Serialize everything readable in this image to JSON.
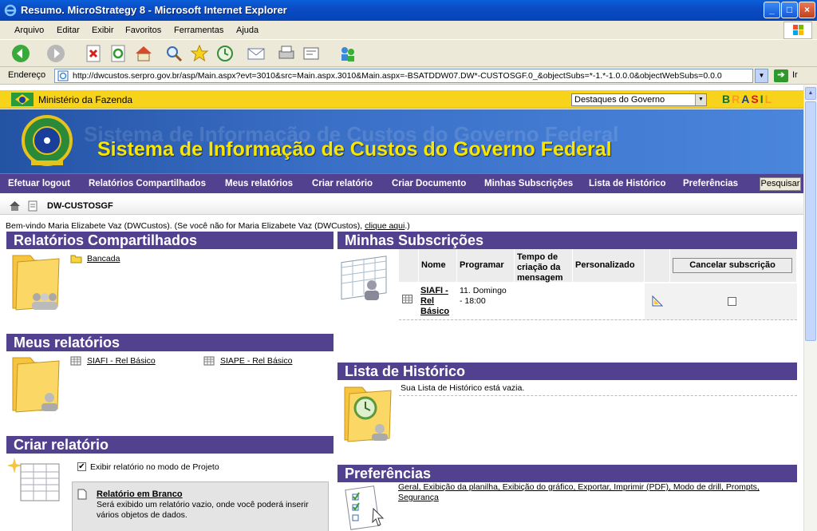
{
  "window": {
    "title": "Resumo. MicroStrategy 8 - Microsoft Internet Explorer",
    "buttons": {
      "minimize": "_",
      "maximize": "□",
      "close": "×"
    }
  },
  "menubar": [
    "Arquivo",
    "Editar",
    "Exibir",
    "Favoritos",
    "Ferramentas",
    "Ajuda"
  ],
  "addressbar": {
    "label": "Endereço",
    "url": "http://dwcustos.serpro.gov.br/asp/Main.aspx?evt=3010&src=Main.aspx.3010&Main.aspx=-BSATDDW07.DW*-CUSTOSGF.0_&objectSubs=*-1.*-1.0.0.0&objectWebSubs=0.0.0",
    "go_label": "Ir"
  },
  "gov": {
    "ministry": "Ministério da Fazenda",
    "select": "Destaques do Governo",
    "logo": "BRASIL"
  },
  "banner": {
    "title": "Sistema de Informação de Custos do Governo Federal"
  },
  "nav": {
    "items": [
      "Efetuar logout",
      "Relatórios Compartilhados",
      "Meus relatórios",
      "Criar relatório",
      "Criar Documento",
      "Minhas Subscrições",
      "Lista de Histórico",
      "Preferências"
    ],
    "search": "Pesquisar"
  },
  "breadcrumb": {
    "project": "DW-CUSTOSGF"
  },
  "welcome": {
    "text": "Bem-vindo Maria Elizabete Vaz (DWCustos). (Se você não for Maria Elizabete Vaz (DWCustos), ",
    "link": "clique aqui",
    "tail": ".)"
  },
  "shared_reports": {
    "title": "Relatórios Compartilhados",
    "folders": [
      "Bancada"
    ]
  },
  "my_reports": {
    "title": "Meus relatórios",
    "items": [
      "SIAFI - Rel Básico",
      "SIAPE - Rel Básico"
    ]
  },
  "create_report": {
    "title": "Criar relatório",
    "checkbox_label": "Exibir relatório no modo de Projeto",
    "checkbox_checked": true,
    "blank_title": "Relatório em Branco",
    "blank_desc": "Será exibido um relatório vazio, onde você poderá inserir vários objetos de dados."
  },
  "subscriptions": {
    "title": "Minhas Subscrições",
    "headers": [
      "Nome",
      "Programar",
      "Tempo de criação da mensagem",
      "Personalizado"
    ],
    "cancel_button": "Cancelar subscrição",
    "rows": [
      {
        "name": "SIAFI - Rel Básico",
        "schedule": "11. Domingo - 18:00",
        "created": "",
        "custom": ""
      }
    ]
  },
  "history": {
    "title": "Lista de Histórico",
    "empty_text": "Sua Lista de Histórico está vazia."
  },
  "preferences": {
    "title": "Preferências",
    "links": "Geral, Exibição da planilha, Exibição do gráfico, Exportar, Imprimir (PDF), Modo de drill, Prompts, Segurança"
  },
  "colors": {
    "nav_purple": "#52418f",
    "gov_yellow": "#f7d41b",
    "banner_blue": "#3a6fc6",
    "title_yellow": "#f7e600"
  }
}
